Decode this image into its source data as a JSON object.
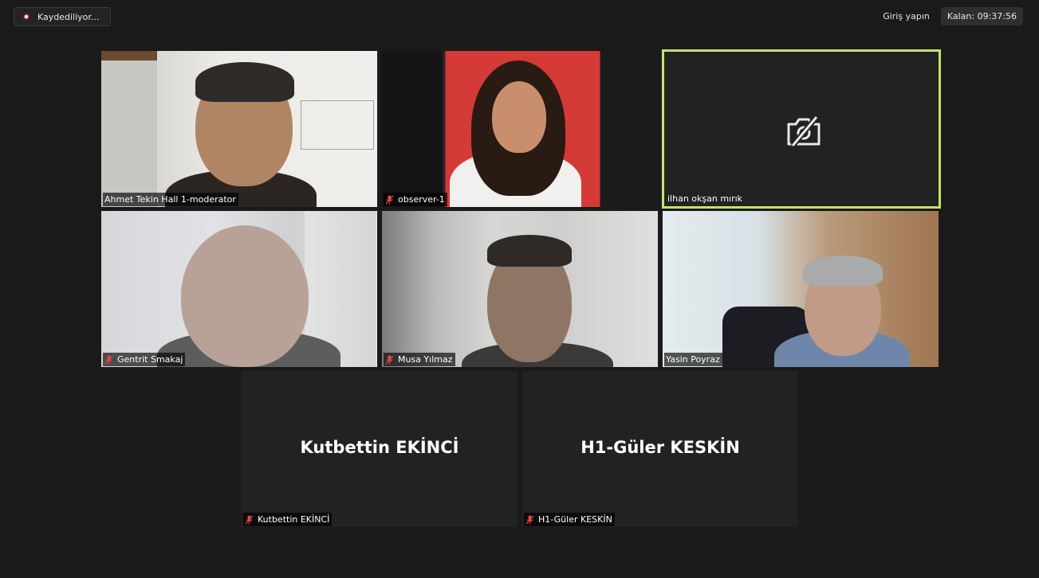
{
  "recording": {
    "label": "Kaydediliyor..."
  },
  "top_right": {
    "login": "Giriş yapın",
    "timer": "Kalan: 09:37:56"
  },
  "participants": [
    {
      "name": "Ahmet Tekin Hall 1-moderator",
      "muted": false,
      "video": true
    },
    {
      "name": "observer-1",
      "muted": true,
      "video": true
    },
    {
      "name": "ilhan okşan mırık",
      "muted": false,
      "video": false,
      "active_speaker": true
    },
    {
      "name": "Gentrit Smakaj",
      "muted": true,
      "video": true
    },
    {
      "name": "Musa Yılmaz",
      "muted": true,
      "video": true
    },
    {
      "name": "Yasin Poyraz",
      "muted": false,
      "video": true
    },
    {
      "name": "Kutbettin EKİNCİ",
      "muted": true,
      "video": false,
      "display_name": "Kutbettin EKİNCİ"
    },
    {
      "name": "H1-Güler KESKİN",
      "muted": true,
      "video": false,
      "display_name": "H1-Güler KESKİN"
    }
  ],
  "colors": {
    "background": "#1a1a1a",
    "active_border": "#c4e36a",
    "mute_icon": "#e54646"
  },
  "icons": {
    "camera_off": "camera-off-icon",
    "mic_off": "mic-off-icon",
    "record": "record-icon"
  }
}
